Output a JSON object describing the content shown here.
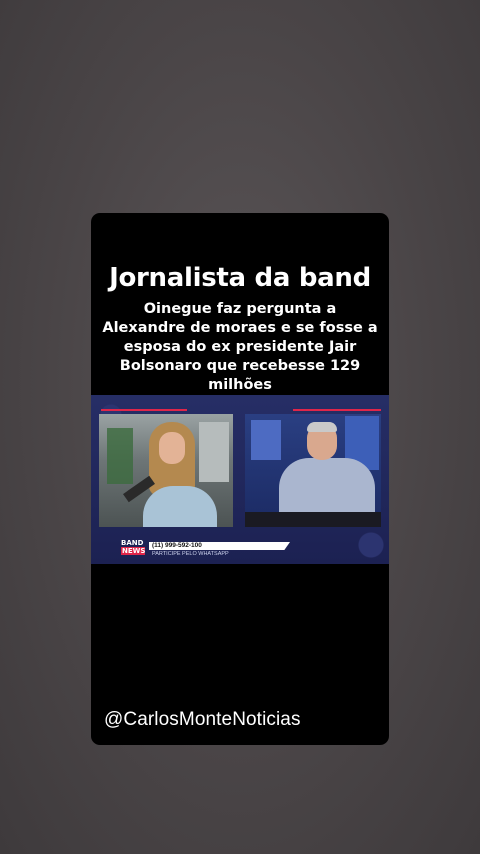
{
  "story": {
    "headline": "Jornalista da band",
    "subtitle": "Oinegue faz pergunta a Alexandre de moraes e se fosse a esposa do ex presidente Jair Bolsonaro que recebesse 129 milhões",
    "handle": "@CarlosMonteNoticias"
  },
  "video": {
    "logo_top": "BAND",
    "logo_bottom": "NEWS",
    "phone": "(11) 999-592-100",
    "cta": "PARTICIPE PELO WHATSAPP"
  },
  "colors": {
    "background": "#4a4648",
    "card": "#000000",
    "accent_red": "#e0264a",
    "studio_blue": "#20275a"
  }
}
